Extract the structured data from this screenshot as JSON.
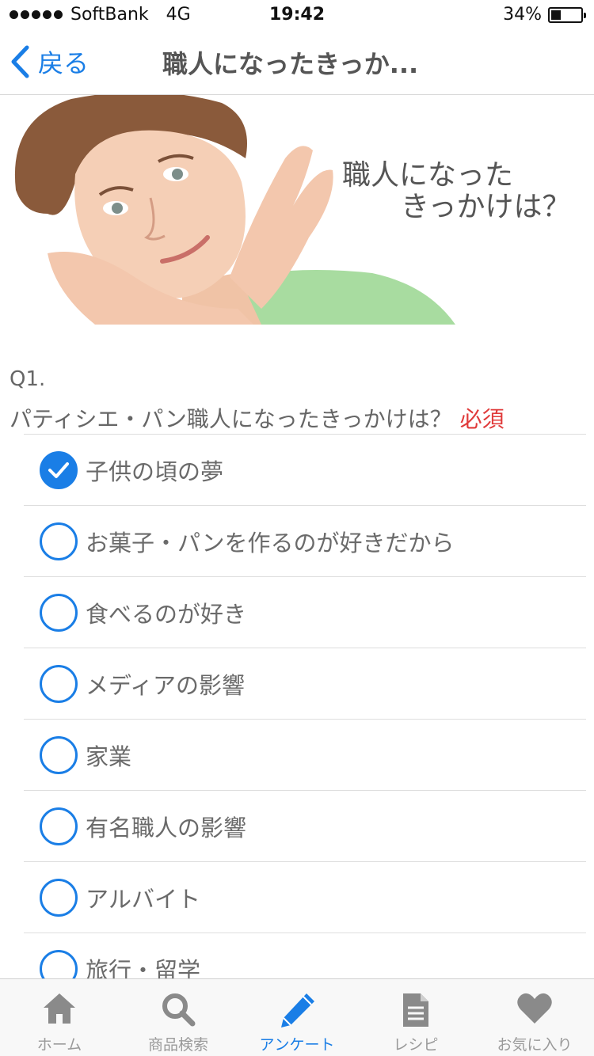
{
  "status_bar": {
    "carrier": "SoftBank",
    "network": "4G",
    "time": "19:42",
    "battery": "34%",
    "battery_level": 0.34
  },
  "nav": {
    "back_label": "戻る",
    "title": "職人になったきっか..."
  },
  "hero": {
    "line1": "職人になった",
    "line2": "きっかけは？"
  },
  "question": {
    "number": "Q1.",
    "text": "パティシエ・パン職人になったきっかけは？",
    "required": "必須",
    "options": [
      {
        "label": "子供の頃の夢",
        "checked": true
      },
      {
        "label": "お菓子・パンを作るのが好きだから",
        "checked": false
      },
      {
        "label": "食べるのが好き",
        "checked": false
      },
      {
        "label": "メディアの影響",
        "checked": false
      },
      {
        "label": "家業",
        "checked": false
      },
      {
        "label": "有名職人の影響",
        "checked": false
      },
      {
        "label": "アルバイト",
        "checked": false
      },
      {
        "label": "旅行・留学",
        "checked": false
      }
    ]
  },
  "tabs": [
    {
      "label": "ホーム",
      "icon": "home-icon",
      "active": false
    },
    {
      "label": "商品検索",
      "icon": "search-icon",
      "active": false
    },
    {
      "label": "アンケート",
      "icon": "pencil-icon",
      "active": true
    },
    {
      "label": "レシピ",
      "icon": "document-icon",
      "active": false
    },
    {
      "label": "お気に入り",
      "icon": "heart-icon",
      "active": false
    }
  ],
  "colors": {
    "accent": "#1a7ee6",
    "required": "#e03a3a"
  }
}
